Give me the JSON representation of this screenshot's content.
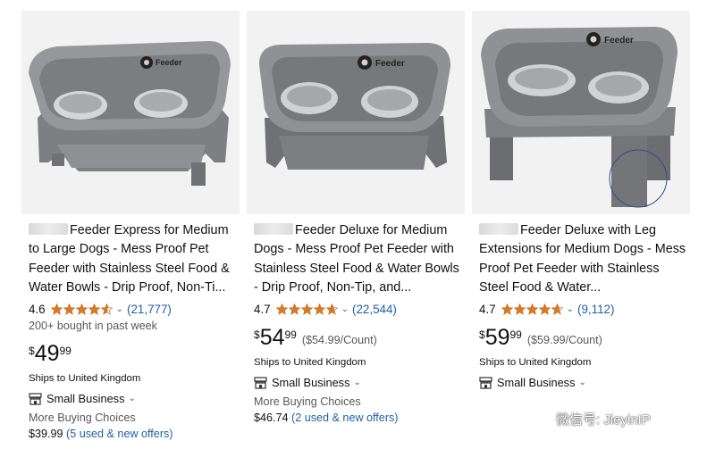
{
  "products": [
    {
      "title": "Feeder Express for Medium to Large Dogs - Mess Proof Pet Feeder with Stainless Steel Food & Water Bowls - Drip Proof, Non-Ti...",
      "rating": "4.6",
      "review_count": "(21,777)",
      "bought": "200+ bought in past week",
      "price_symbol": "$",
      "price_whole": "49",
      "price_fraction": "99",
      "unit_price": "",
      "ships": "Ships to United Kingdom",
      "small_business": "Small Business",
      "more_buying": "More Buying Choices",
      "offer_price": "$39.99",
      "offer_link": "(5 used & new offers)",
      "brand_label": "Feeder"
    },
    {
      "title": "Feeder Deluxe for Medium Dogs - Mess Proof Pet Feeder with Stainless Steel Food & Water Bowls - Drip Proof, Non-Tip, and...",
      "rating": "4.7",
      "review_count": "(22,544)",
      "bought": "",
      "price_symbol": "$",
      "price_whole": "54",
      "price_fraction": "99",
      "unit_price": "($54.99/Count)",
      "ships": "Ships to United Kingdom",
      "small_business": "Small Business",
      "more_buying": "More Buying Choices",
      "offer_price": "$46.74",
      "offer_link": "(2 used & new offers)",
      "brand_label": "Feeder"
    },
    {
      "title": "Feeder Deluxe with Leg Extensions for Medium Dogs - Mess Proof Pet Feeder with Stainless Steel Food & Water...",
      "rating": "4.7",
      "review_count": "(9,112)",
      "bought": "",
      "price_symbol": "$",
      "price_whole": "59",
      "price_fraction": "99",
      "unit_price": "($59.99/Count)",
      "ships": "Ships to United Kingdom",
      "small_business": "Small Business",
      "more_buying": "",
      "offer_price": "",
      "offer_link": "",
      "brand_label": "Feeder"
    }
  ],
  "watermark": {
    "text": "微信号: JieyinIP",
    "icon": "wechat-icon"
  },
  "colors": {
    "link": "#2162a1",
    "star": "#de7921",
    "text": "#0f1111",
    "muted": "#565959",
    "image_bg": "#f2f2f2"
  }
}
